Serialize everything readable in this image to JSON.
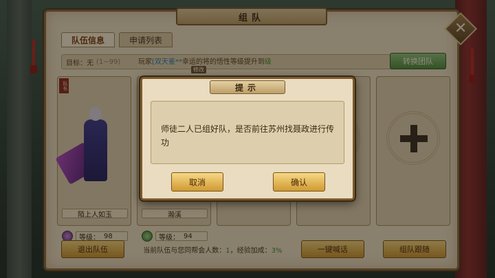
{
  "window": {
    "title": "组队",
    "close_glyph": "✕"
  },
  "tabs": [
    {
      "label": "队伍信息",
      "active": true
    },
    {
      "label": "申请列表",
      "active": false
    }
  ],
  "target": {
    "label": "目标：无",
    "range": "(1~99)"
  },
  "notice": {
    "prefix": "玩家",
    "player": "[双天鉴**",
    "middle": "幸运的将",
    "tail": "的悟性等级提升到",
    "unit": "级"
  },
  "modify_label": "修改",
  "switch_button": "转换团队",
  "members": [
    {
      "leader_badge": "队长",
      "name": "陌上人如玉",
      "level_label": "等级：",
      "level": "98"
    },
    {
      "name": "瀚溪",
      "level_label": "等级：",
      "level": "94"
    }
  ],
  "bottom": {
    "leave_button": "退出队伍",
    "info_prefix": "当前队伍与您同帮会人数：",
    "info_count": "1",
    "info_mid": "，经验加成：",
    "info_bonus": "3%",
    "shout_button": "一键喊话",
    "follow_button": "组队跟随"
  },
  "dialog": {
    "title": "提示",
    "message": "师徒二人已组好队，是否前往苏州找聂政进行传功",
    "cancel": "取消",
    "confirm": "确认"
  },
  "colors": {
    "panel_bg": "#e9dcc0",
    "border": "#8a6a3c",
    "gold_button": "#e8b652",
    "green_button": "#6aa456"
  }
}
